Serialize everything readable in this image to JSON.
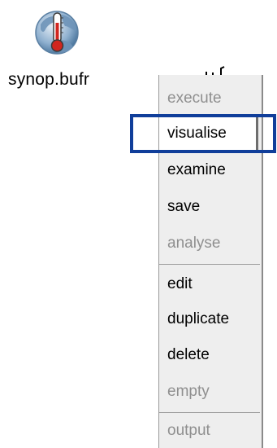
{
  "desktop": {
    "file_icon": "thermometer-globe-icon",
    "file_name": "synop.bufr"
  },
  "context_menu": {
    "items": [
      {
        "label": "execute",
        "enabled": false
      },
      {
        "label": "visualise",
        "enabled": true,
        "selected": true
      },
      {
        "label": "examine",
        "enabled": true
      },
      {
        "label": "save",
        "enabled": true
      },
      {
        "label": "analyse",
        "enabled": false
      },
      {
        "label": "edit",
        "enabled": true
      },
      {
        "label": "duplicate",
        "enabled": true
      },
      {
        "label": "delete",
        "enabled": true
      },
      {
        "label": "empty",
        "enabled": false
      },
      {
        "label": "output",
        "enabled": false
      }
    ]
  },
  "highlight_color": "#103e9a"
}
